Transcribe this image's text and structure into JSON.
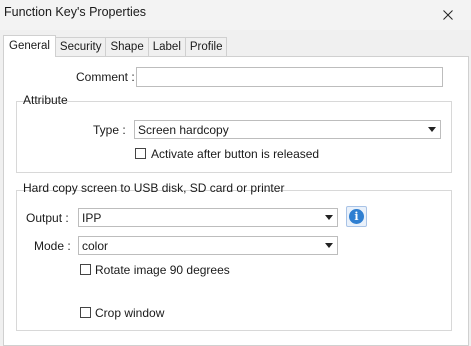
{
  "window": {
    "title": "Function Key's Properties"
  },
  "tabs": [
    "General",
    "Security",
    "Shape",
    "Label",
    "Profile"
  ],
  "general": {
    "comment_label": "Comment :",
    "comment_value": "",
    "attribute": {
      "title": "Attribute",
      "type_label": "Type :",
      "type_value": "Screen hardcopy",
      "activate_label": "Activate after button is released",
      "activate_checked": false
    },
    "hardcopy": {
      "title": "Hard copy screen to USB disk, SD card or printer",
      "output_label": "Output :",
      "output_value": "IPP",
      "mode_label": "Mode :",
      "mode_value": "color",
      "rotate_label": "Rotate image 90 degrees",
      "rotate_checked": false,
      "crop_label": "Crop window",
      "crop_checked": false
    }
  },
  "icons": {
    "close": "close-icon",
    "info": "info-icon",
    "dropdown": "chevron-down-icon"
  },
  "colors": {
    "info_blue": "#2f7fd1"
  }
}
